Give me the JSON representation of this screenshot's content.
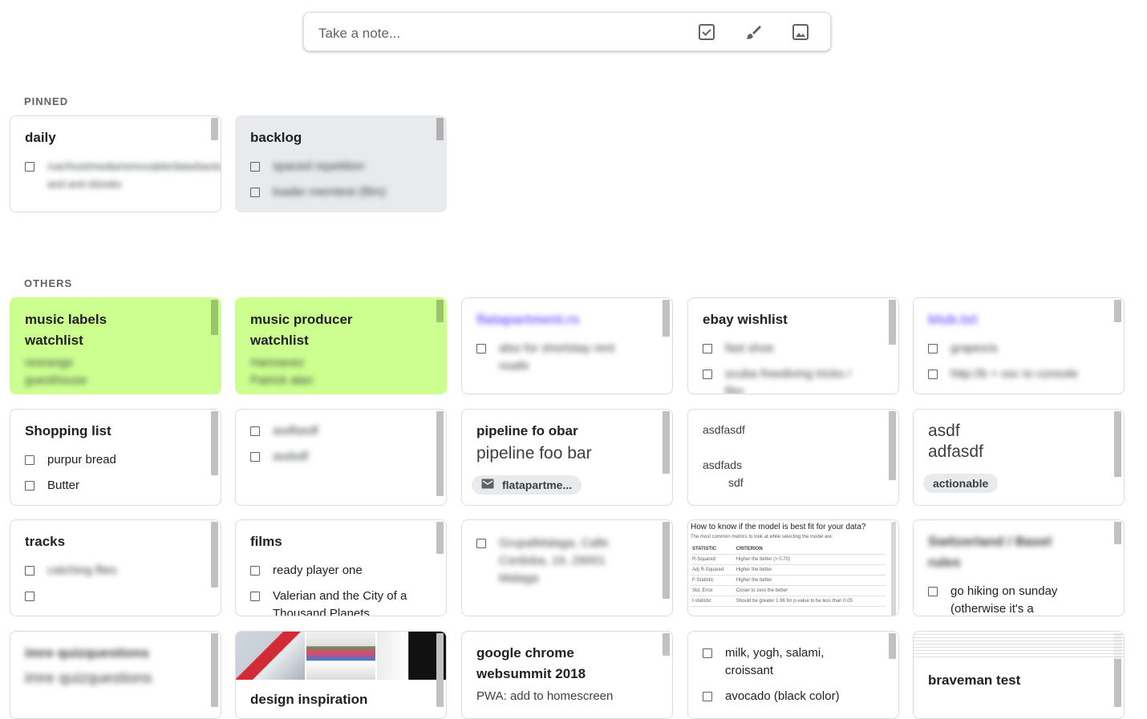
{
  "take_note": {
    "placeholder": "Take a note..."
  },
  "sections": {
    "pinned": "PINNED",
    "others": "OTHERS"
  },
  "pinned": {
    "daily": {
      "title": "daily",
      "items": [
        "/var/host/media/removable/data/backup/prms and and ebooks"
      ]
    },
    "backlog": {
      "title": "backlog",
      "items": [
        "spaced repetition",
        "loader memtest (film)"
      ]
    }
  },
  "others": {
    "music_labels": {
      "title": "music labels watchlist",
      "lines": [
        "reorange",
        "guesthouse"
      ]
    },
    "music_producer": {
      "title": "music producer watchlist",
      "lines": [
        "Hannavez",
        "Patrick alan"
      ]
    },
    "flatapartment": {
      "title": "flatapartment.rs",
      "items": [
        "also for shortstay rent noafe"
      ]
    },
    "ebay": {
      "title": "ebay wishlist",
      "items": [
        "fast shoe",
        "scuba freediving tricks / film"
      ]
    },
    "blub": {
      "title": "blub.txt",
      "items": [
        "grapes/a",
        "http://b + osc to console"
      ]
    },
    "shopping": {
      "title": "Shopping list",
      "items": [
        "purpur bread",
        "Butter"
      ]
    },
    "asdf_checks": {
      "items": [
        "asdfasdf",
        "asdsdf"
      ]
    },
    "pipeline": {
      "title": "pipeline fo obar",
      "body": "pipeline foo bar",
      "chip": "flatapartme..."
    },
    "asdfasdf_note": {
      "line1": "asdfasdf",
      "line2": "asdfads",
      "line3": "sdf"
    },
    "asdf_big": {
      "line1": "asdf",
      "line2": "adfasdf",
      "chip": "actionable"
    },
    "tracks": {
      "title": "tracks",
      "items": [
        "catching flies",
        ""
      ]
    },
    "films": {
      "title": "films",
      "items": [
        "ready player one",
        "Valerian and the City of a Thousand Planets"
      ]
    },
    "address": {
      "items": [
        "GrupalMalaga, Calle Cordoba, 19, 29001 Malaga"
      ]
    },
    "model_fit": {
      "heading": "How to know if the model is best fit for your data?",
      "sub": "The most common metrics to look at while selecting the model are:",
      "col1": "STATISTIC",
      "col2": "CRITERION",
      "rows": [
        [
          "R-Squared",
          "Higher the better (> 0.70)"
        ],
        [
          "Adj R-Squared",
          "Higher the better"
        ],
        [
          "F-Statistic",
          "Higher the better"
        ],
        [
          "Std. Error",
          "Closer to zero the better"
        ],
        [
          "t-statistic",
          "Should be greater 1.96 for p-value to be less than 0.05"
        ]
      ]
    },
    "switzerland": {
      "title": "Switzerland / Basel rules",
      "items": [
        "go hiking on sunday (otherwise it's a"
      ]
    },
    "imre": {
      "title": "imre quizquestions",
      "body": "imre quizquestions"
    },
    "design": {
      "title": "design inspiration"
    },
    "chrome": {
      "title": "google chrome websummit 2018",
      "body": "PWA: add to homescreen"
    },
    "grocery": {
      "items": [
        "milk, yogh, salami, croissant",
        "avocado (black color)"
      ]
    },
    "braveman": {
      "title": "braveman test"
    }
  }
}
